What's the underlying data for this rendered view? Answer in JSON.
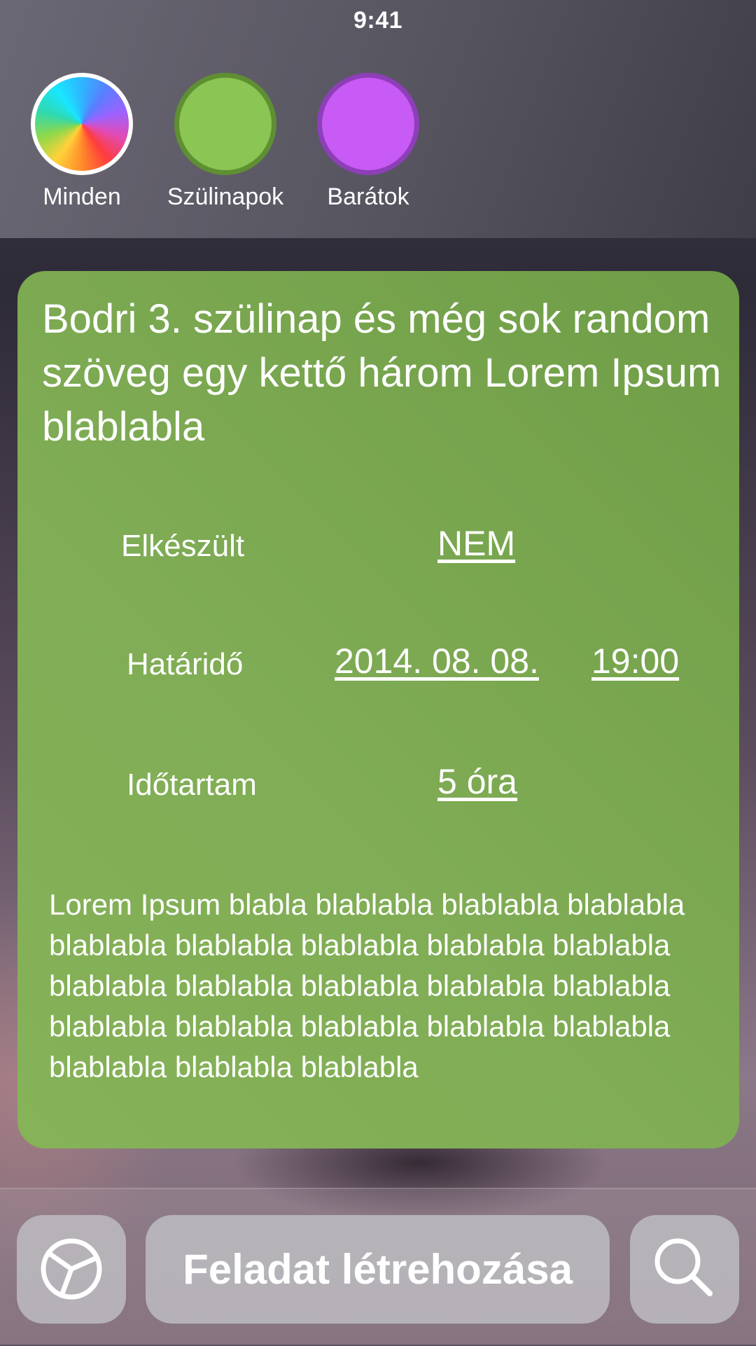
{
  "status_bar": {
    "time": "9:41"
  },
  "filters": [
    {
      "label": "Minden",
      "icon": "rainbow-color-wheel"
    },
    {
      "label": "Szülinapok",
      "color": "#8bc553"
    },
    {
      "label": "Barátok",
      "color": "#c85af5"
    }
  ],
  "task": {
    "title": "Bodri 3. szülinap és még sok random szöveg egy kettő három Lorem Ipsum blablabla",
    "done_label": "Elkészült",
    "done_value": "NEM",
    "deadline_label": "Határidő",
    "deadline_date": "2014. 08. 08.",
    "deadline_time": "19:00",
    "duration_label": "Időtartam",
    "duration_value": "5 óra",
    "description": "Lorem Ipsum blabla blablabla blablabla blablabla blablabla blablabla blablabla blablabla blablabla blablabla blablabla blablabla blablabla blablabla blablabla blablabla blablabla blablabla blablabla blablabla blablabla blablabla",
    "card_color": "#7ba84f"
  },
  "bottom_bar": {
    "stats_icon": "pie-chart-icon",
    "create_label": "Feladat létrehozása",
    "search_icon": "search-icon"
  }
}
